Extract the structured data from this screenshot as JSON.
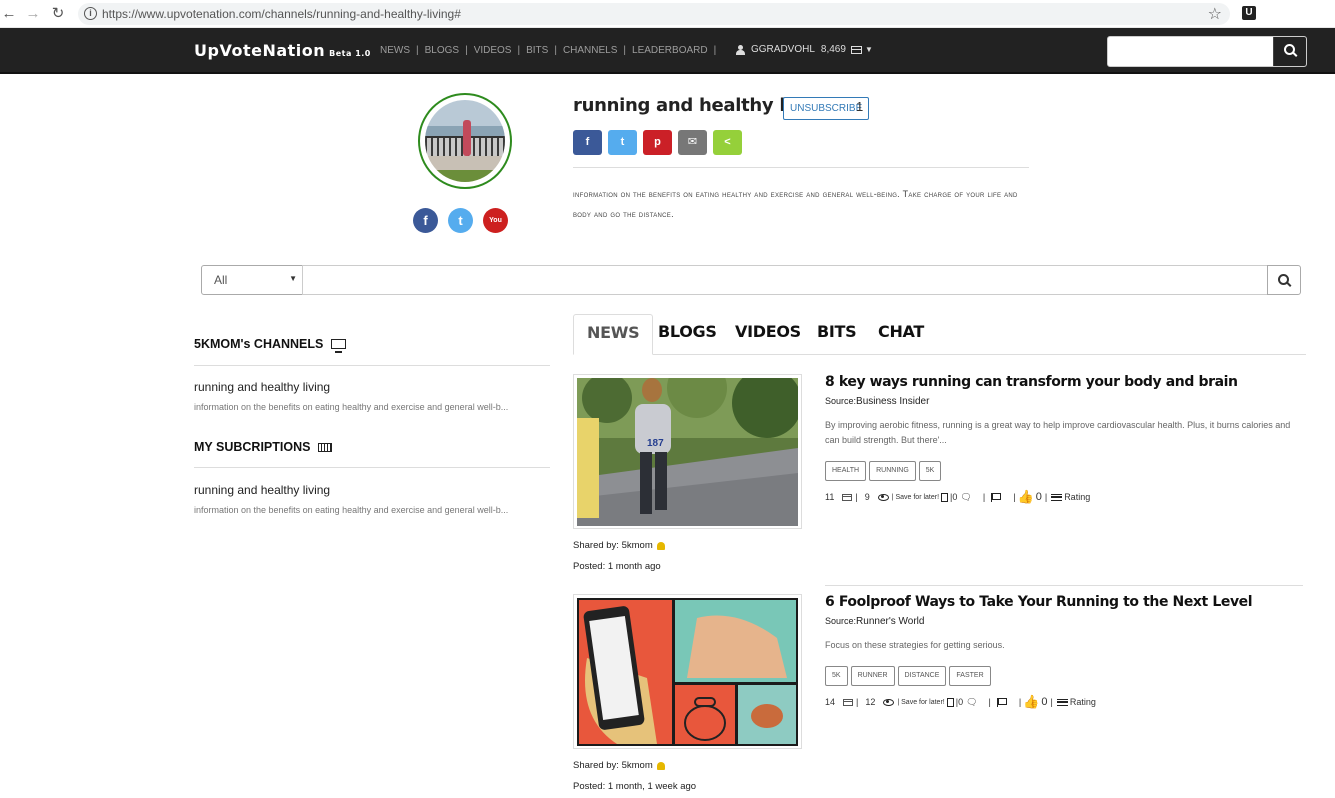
{
  "browser": {
    "url": "https://www.upvotenation.com/channels/running-and-healthy-living#",
    "back_icon": "arrow-left-icon",
    "forward_icon": "arrow-right-icon",
    "reload_icon": "reload-icon",
    "extension_label": "U"
  },
  "nav": {
    "brand": "UpVoteNation",
    "beta": "Beta 1.0",
    "links": [
      "NEWS",
      "BLOGS",
      "VIDEOS",
      "BITS",
      "CHANNELS",
      "LEADERBOARD"
    ],
    "separator": "|",
    "username": "GGRADVOHL",
    "points": "8,469"
  },
  "channel": {
    "title": "running and healthy living",
    "unsubscribe_label": "UNSUBSCRIBE",
    "subscriber_count": "1",
    "description": "information on the benefits on eating healthy and exercise and general well-being. Take charge of your life and body and go the distance.",
    "social": [
      "f",
      "t",
      "You Tube"
    ],
    "share": [
      "f",
      "t",
      "p",
      "✉",
      "<"
    ]
  },
  "search": {
    "filter_value": "All",
    "placeholder": ""
  },
  "sidebar": {
    "channels_heading": "5KMOM's CHANNELS",
    "channels": [
      {
        "title": "running and healthy living",
        "desc": "information on the benefits on eating healthy and exercise and general well-b..."
      }
    ],
    "subscriptions_heading": "MY SUBCRIPTIONS",
    "subscriptions": [
      {
        "title": "running and healthy living",
        "desc": "information on the benefits on eating healthy and exercise and general well-b..."
      }
    ]
  },
  "tabs": [
    "NEWS",
    "BLOGS",
    "VIDEOS",
    "BITS",
    "CHAT"
  ],
  "labels": {
    "source": "Source:",
    "shared_by": "Shared by:",
    "posted": "Posted:",
    "save_for_later": "| Save for later!",
    "rating": "Rating",
    "bar": "|"
  },
  "articles": [
    {
      "title": "8 key ways running can transform your body and brain",
      "source": "Business Insider",
      "snippet": "By improving aerobic fitness, running is a great way to help improve cardiovascular health. Plus, it burns calories and can build strength. But there'...",
      "tags": [
        "HEALTH",
        "RUNNING",
        "5K"
      ],
      "points": "11",
      "views": "9",
      "comments": "0",
      "likes": "0",
      "shared_by": "5kmom",
      "posted": "1 month ago",
      "bib_number": "187"
    },
    {
      "title": "6 Foolproof Ways to Take Your Running to the Next Level",
      "source": "Runner's World",
      "snippet": "Focus on these strategies for getting serious.",
      "tags": [
        "5K",
        "RUNNER",
        "DISTANCE",
        "FASTER"
      ],
      "points": "14",
      "views": "12",
      "comments": "0",
      "likes": "0",
      "shared_by": "5kmom",
      "posted": "1 month, 1 week ago"
    }
  ]
}
